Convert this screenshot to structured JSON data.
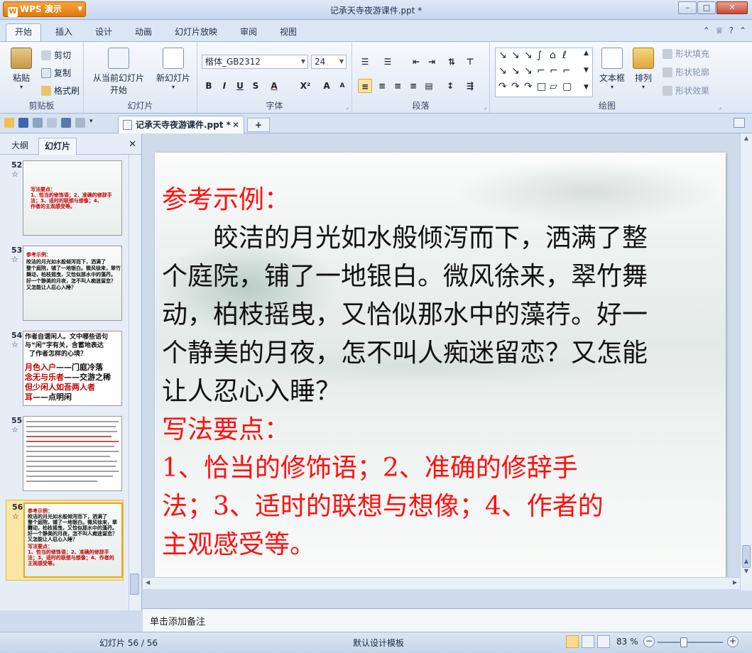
{
  "window": {
    "app_name": "WPS 演示",
    "title": "记承天寺夜游课件.ppt *",
    "min": "–",
    "max": "□",
    "close": "✕"
  },
  "ribbon_tabs": [
    "开始",
    "插入",
    "设计",
    "动画",
    "幻灯片放映",
    "审阅",
    "视图"
  ],
  "clipboard": {
    "paste": "粘贴",
    "cut": "剪切",
    "copy": "复制",
    "format_painter": "格式刷",
    "label": "剪贴板"
  },
  "slides_group": {
    "from_current": "从当前幻灯片",
    "start": "开始",
    "new_slide": "新幻灯片",
    "label": "幻灯片"
  },
  "font_group": {
    "font_name": "楷体_GB2312",
    "font_size": "24",
    "label": "字体",
    "bold": "B",
    "italic": "I",
    "underline": "U",
    "shadow": "S",
    "font_color": "A",
    "superscript": "X²",
    "grow": "A",
    "shrink": "A"
  },
  "paragraph_group": {
    "label": "段落"
  },
  "drawing_group": {
    "textbox": "文本框",
    "arrange": "排列",
    "shape_fill": "形状填充",
    "shape_outline": "形状轮廓",
    "shape_effect": "形状效果",
    "label": "绘图"
  },
  "doc_tab": {
    "name": "记承天寺夜游课件.ppt *",
    "close": "✕",
    "new": "+"
  },
  "left_panel": {
    "tabs": [
      "大纲",
      "幻灯片"
    ],
    "close": "✕",
    "thumbnails": [
      {
        "num": "52",
        "star": "☆",
        "lines_red": [
          "写法要点：",
          "1、恰当的修饰语；2、准确的修辞手",
          "法；3、适时的联想与想像；4、",
          "作者的主观感受等。"
        ]
      },
      {
        "num": "53",
        "star": "☆",
        "lines_red": [
          "参考示例："
        ],
        "lines_black": [
          "皎洁的月光如水般倾泻而下，洒满了",
          "整个庭院，铺了一地银白。微风徐来，翠竹",
          "舞动，柏枝摇曳，又恰似那水中的藻荇。",
          "好一个静美的月夜，怎不叫人痴迷留恋？",
          "又怎能让人忍心入睡？"
        ]
      },
      {
        "num": "54",
        "star": "☆",
        "lines_black": [
          "作者自谓闲人。文中哪些语句",
          "与“闲”字有关，含蓄地表达",
          "了作者怎样的心境？"
        ],
        "pairs": [
          [
            "月色入户",
            "——门庭冷落"
          ],
          [
            "念无与乐者",
            "——交游之稀"
          ],
          [
            "但少闲人如吾两人者",
            ""
          ],
          [
            "耳",
            "——点明闲"
          ]
        ]
      },
      {
        "num": "55",
        "star": "☆"
      },
      {
        "num": "56",
        "star": "☆",
        "lines_red": [
          "参考示例："
        ],
        "lines_black": [
          "皎洁的月光如水般倾泻而下，洒满了",
          "整个庭院，铺了一地银白。微风徐来，翠竹",
          "舞动，柏枝摇曳，又恰似那水中的藻荇。",
          "好一个静美的月夜，怎不叫人痴迷留恋？",
          "又怎能让人忍心入睡？"
        ],
        "lines_red2": [
          "写法要点：",
          "1、恰当的修饰语；2、准确的修辞手",
          "法；3、适时的联想与想像；4、作者的",
          "主观感受等。"
        ]
      }
    ]
  },
  "slide": {
    "heading1": "参考示例：",
    "body_lines": [
      "　　皎洁的月光如水般倾泻而下，洒满了整",
      "个庭院，铺了一地银白。微风徐来，翠竹舞",
      "动，柏枝摇曳，又恰似那水中的藻荇。好一",
      "个静美的月夜，怎不叫人痴迷留恋？又怎能",
      "让人忍心入睡？"
    ],
    "heading2": "写法要点：",
    "points_lines": [
      "1、恰当的修饰语；2、准确的修辞手",
      "法；3、适时的联想与想像；4、作者的",
      "主观感受等。"
    ]
  },
  "notes": {
    "placeholder": "单击添加备注"
  },
  "status": {
    "slide_count": "幻灯片 56 / 56",
    "template": "默认设计模板",
    "zoom": "83 %"
  },
  "colors": {
    "title_red": "#ff1010",
    "accent_orange": "#e07808",
    "ribbon_blue": "#dbe6f4"
  }
}
